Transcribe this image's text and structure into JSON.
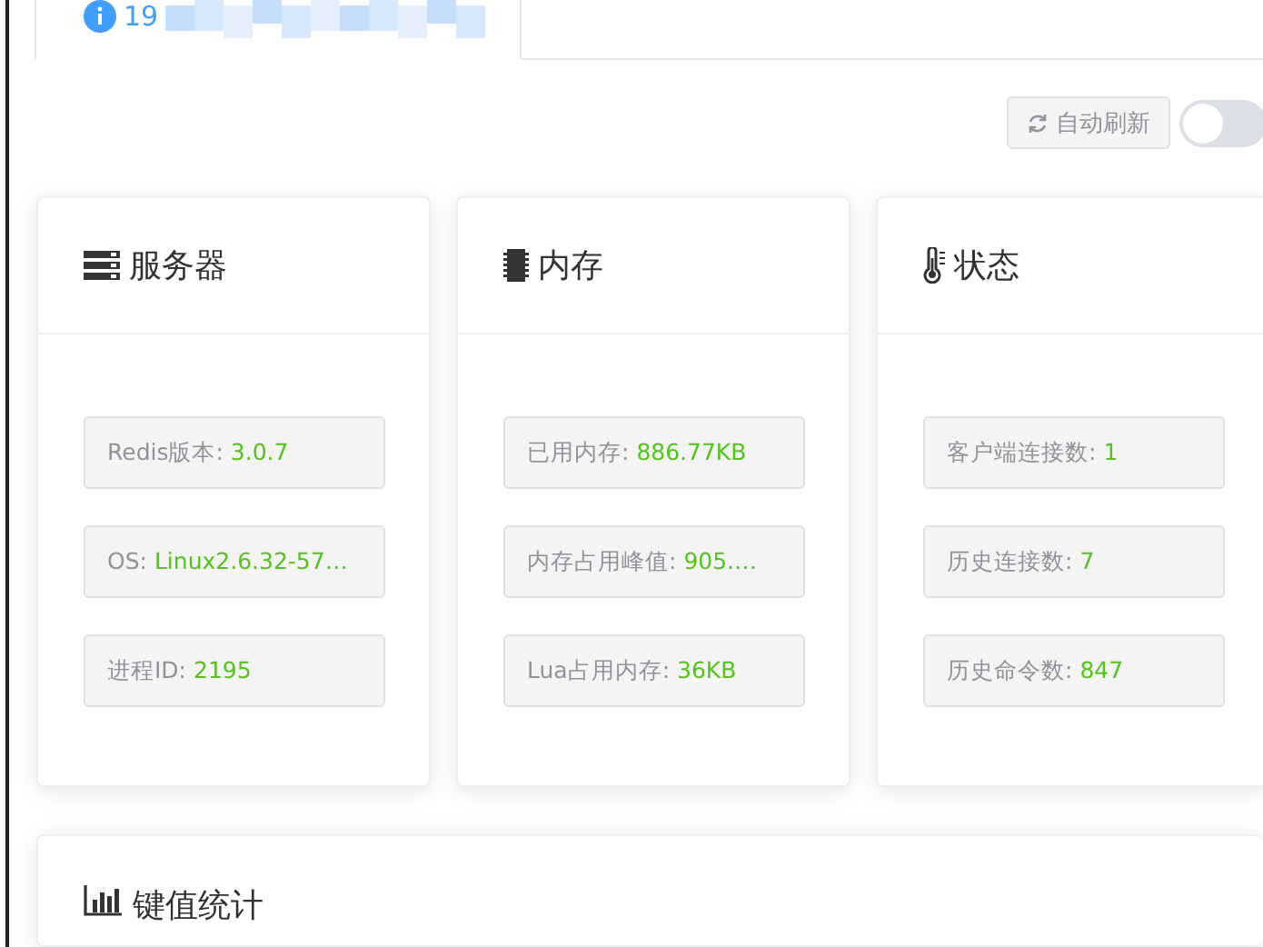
{
  "tab": {
    "label": "19",
    "selected": true
  },
  "toolbar": {
    "refresh_button": "自动刷新",
    "auto_refresh": {
      "on": false
    }
  },
  "cards": [
    {
      "title": "服务器",
      "items": [
        {
          "label": "Redis版本: ",
          "value": "3.0.7"
        },
        {
          "label": "OS: ",
          "value": "Linux2.6.32-57…"
        },
        {
          "label": "进程ID: ",
          "value": "2195"
        }
      ]
    },
    {
      "title": "内存",
      "items": [
        {
          "label": "已用内存: ",
          "value": "886.77KB"
        },
        {
          "label": "内存占用峰值: ",
          "value": "905.…"
        },
        {
          "label": "Lua占用内存: ",
          "value": "36KB"
        }
      ]
    },
    {
      "title": "状态",
      "items": [
        {
          "label": "客户端连接数: ",
          "value": "1"
        },
        {
          "label": "历史连接数: ",
          "value": "7"
        },
        {
          "label": "历史命令数: ",
          "value": "847"
        }
      ]
    }
  ],
  "stats_card": {
    "title": "键值统计"
  }
}
